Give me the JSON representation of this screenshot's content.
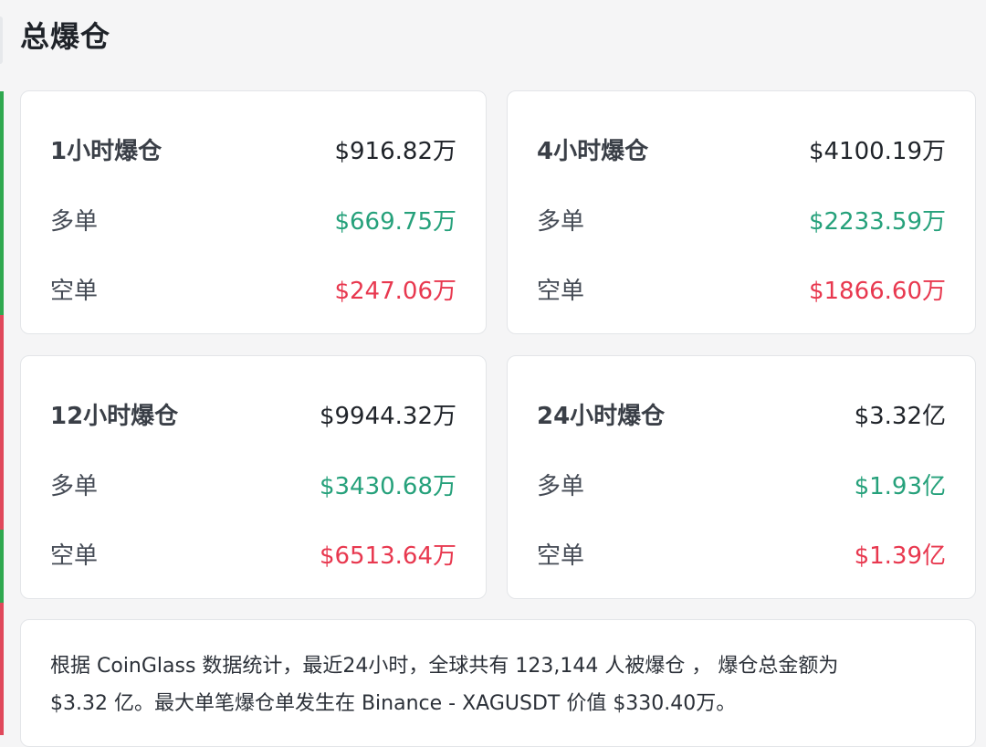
{
  "header": {
    "title": "总爆仓"
  },
  "cards": [
    {
      "period_label": "1小时爆仓",
      "total": "$916.82万",
      "long_label": "多单",
      "long_value": "$669.75万",
      "short_label": "空单",
      "short_value": "$247.06万"
    },
    {
      "period_label": "4小时爆仓",
      "total": "$4100.19万",
      "long_label": "多单",
      "long_value": "$2233.59万",
      "short_label": "空单",
      "short_value": "$1866.60万"
    },
    {
      "period_label": "12小时爆仓",
      "total": "$9944.32万",
      "long_label": "多单",
      "long_value": "$3430.68万",
      "short_label": "空单",
      "short_value": "$6513.64万"
    },
    {
      "period_label": "24小时爆仓",
      "total": "$3.32亿",
      "long_label": "多单",
      "long_value": "$1.93亿",
      "short_label": "空单",
      "short_value": "$1.39亿"
    }
  ],
  "summary": {
    "line1": "根据 CoinGlass 数据统计，最近24小时，全球共有 123,144 人被爆仓 ， 爆仓总金额为",
    "line2": "$3.32 亿。最大单笔爆仓单发生在 Binance - XAGUSDT 价值 $330.40万。"
  },
  "colors": {
    "long": "#26a17b",
    "short": "#e8384f",
    "text": "#1f2329",
    "background": "#f5f5f6"
  }
}
